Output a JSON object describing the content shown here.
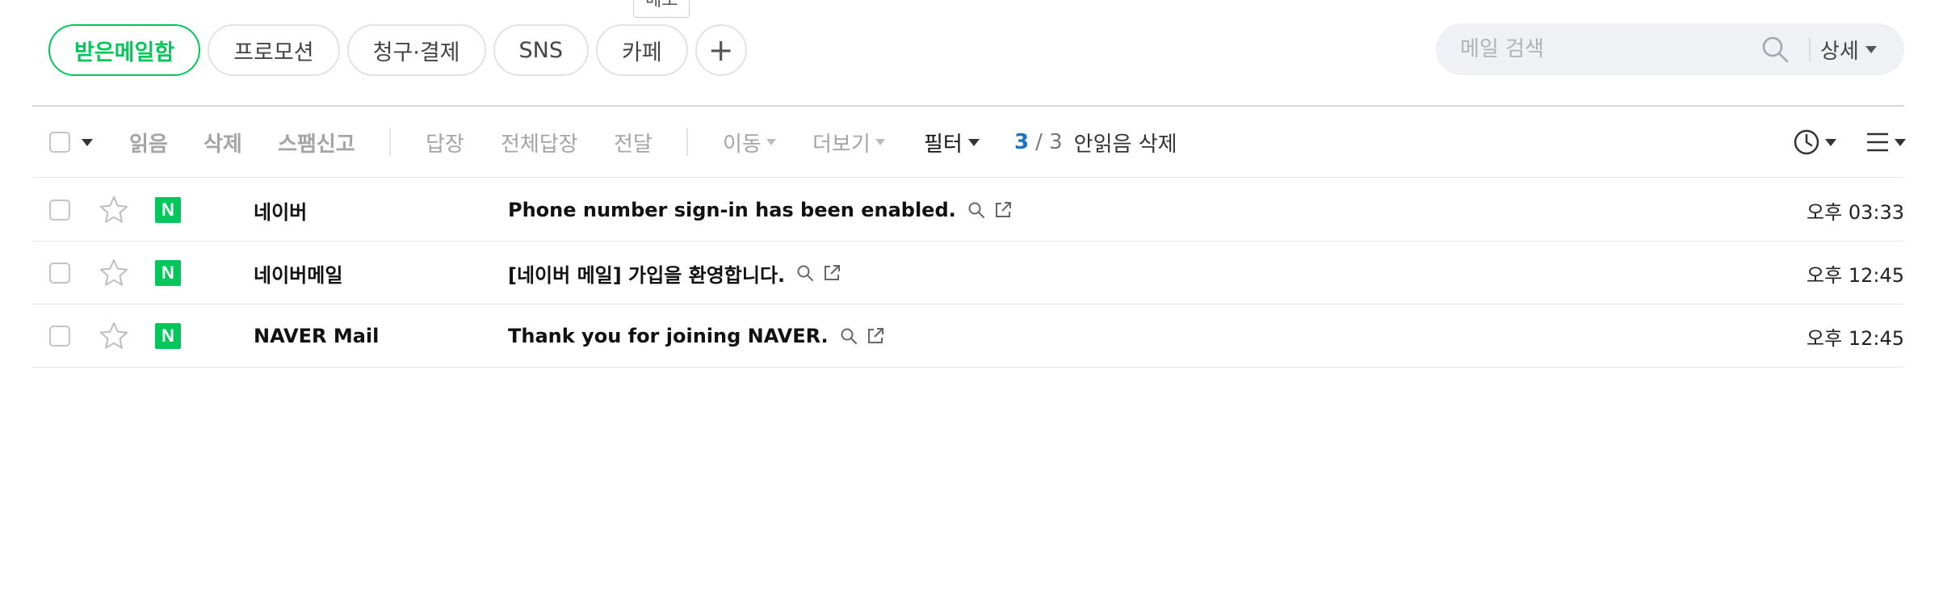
{
  "tooltip": {
    "text": "메모"
  },
  "tabs": [
    {
      "label": "받은메일함",
      "active": true
    },
    {
      "label": "프로모션"
    },
    {
      "label": "청구·결제"
    },
    {
      "label": "SNS"
    },
    {
      "label": "카페"
    }
  ],
  "tab_add": {
    "label": "+"
  },
  "search": {
    "placeholder": "메일 검색",
    "detail_label": "상세",
    "icon": "search-icon"
  },
  "toolbar": {
    "read": "읽음",
    "delete": "삭제",
    "spam": "스팸신고",
    "reply": "답장",
    "reply_all": "전체답장",
    "forward": "전달",
    "move": "이동",
    "more": "더보기",
    "filter": "필터",
    "count_unread": "3",
    "count_total": "/ 3",
    "unread_delete": "안읽음 삭제"
  },
  "mails": [
    {
      "sender": "네이버",
      "subject": "Phone number sign-in has been enabled.",
      "time": "오후 03:33"
    },
    {
      "sender": "네이버메일",
      "subject": "[네이버 메일] 가입을 환영합니다.",
      "time": "오후 12:45"
    },
    {
      "sender": "NAVER Mail",
      "subject": "Thank you for joining NAVER.",
      "time": "오후 12:45"
    }
  ],
  "colors": {
    "brand": "#03c75a",
    "count_accent": "#1a73c8"
  }
}
